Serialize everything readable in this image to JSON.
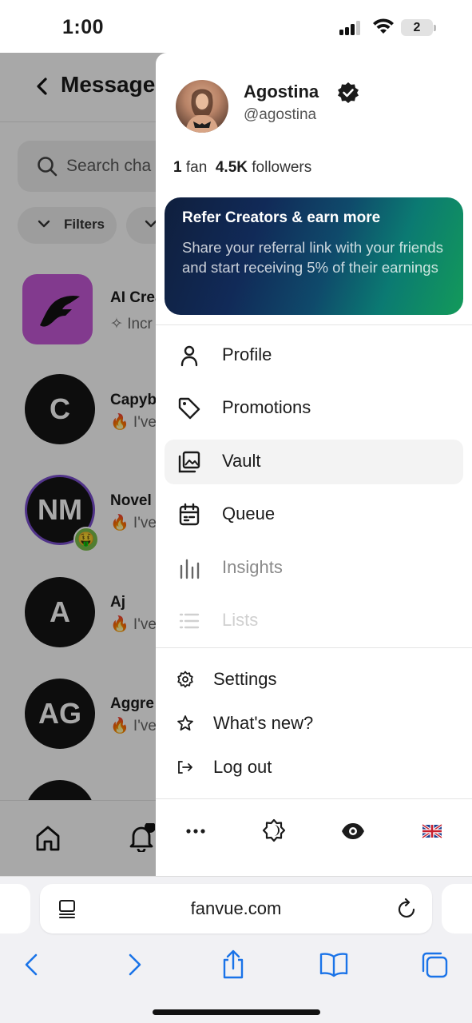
{
  "status_bar": {
    "time": "1:00",
    "battery": "2"
  },
  "background_app": {
    "title": "Message",
    "search_placeholder": "Search cha",
    "filter_label": "Filters",
    "chats": [
      {
        "initials": "",
        "name": "AI Crea",
        "sub": "✧ Incr"
      },
      {
        "initials": "C",
        "name": "Capyb",
        "sub": "🔥 I've"
      },
      {
        "initials": "NM",
        "name": "Novel",
        "sub": "🔥 I've",
        "badge": "🤑"
      },
      {
        "initials": "A",
        "name": "Aj",
        "sub": "🔥 I've"
      },
      {
        "initials": "AG",
        "name": "Aggre",
        "sub": "🔥 I've"
      }
    ],
    "notification_count": "1"
  },
  "drawer": {
    "profile": {
      "name": "Agostina",
      "handle": "@agostina",
      "fans_count": "1",
      "fans_label": "fan",
      "followers_count": "4.5K",
      "followers_label": "followers"
    },
    "refer_card": {
      "title": "Refer Creators & earn more",
      "body": "Share your referral link with your friends and start receiving 5% of their earnings"
    },
    "menu": [
      {
        "label": "Profile",
        "icon": "person-icon"
      },
      {
        "label": "Promotions",
        "icon": "tag-icon"
      },
      {
        "label": "Vault",
        "icon": "gallery-icon",
        "active": true
      },
      {
        "label": "Queue",
        "icon": "calendar-icon"
      },
      {
        "label": "Insights",
        "icon": "bar-chart-icon"
      },
      {
        "label": "Lists",
        "icon": "list-icon"
      }
    ],
    "secondary": [
      {
        "label": "Settings",
        "icon": "gear-icon"
      },
      {
        "label": "What's new?",
        "icon": "star-icon"
      },
      {
        "label": "Log out",
        "icon": "logout-icon"
      }
    ],
    "toolbar": [
      "more-icon",
      "theme-icon",
      "eye-icon",
      "uk-flag-icon"
    ]
  },
  "browser": {
    "url": "fanvue.com"
  },
  "colors": {
    "accent_purple": "#c659d8",
    "refer_gradient_start": "#0f1f3d",
    "refer_gradient_end": "#139a5a"
  }
}
